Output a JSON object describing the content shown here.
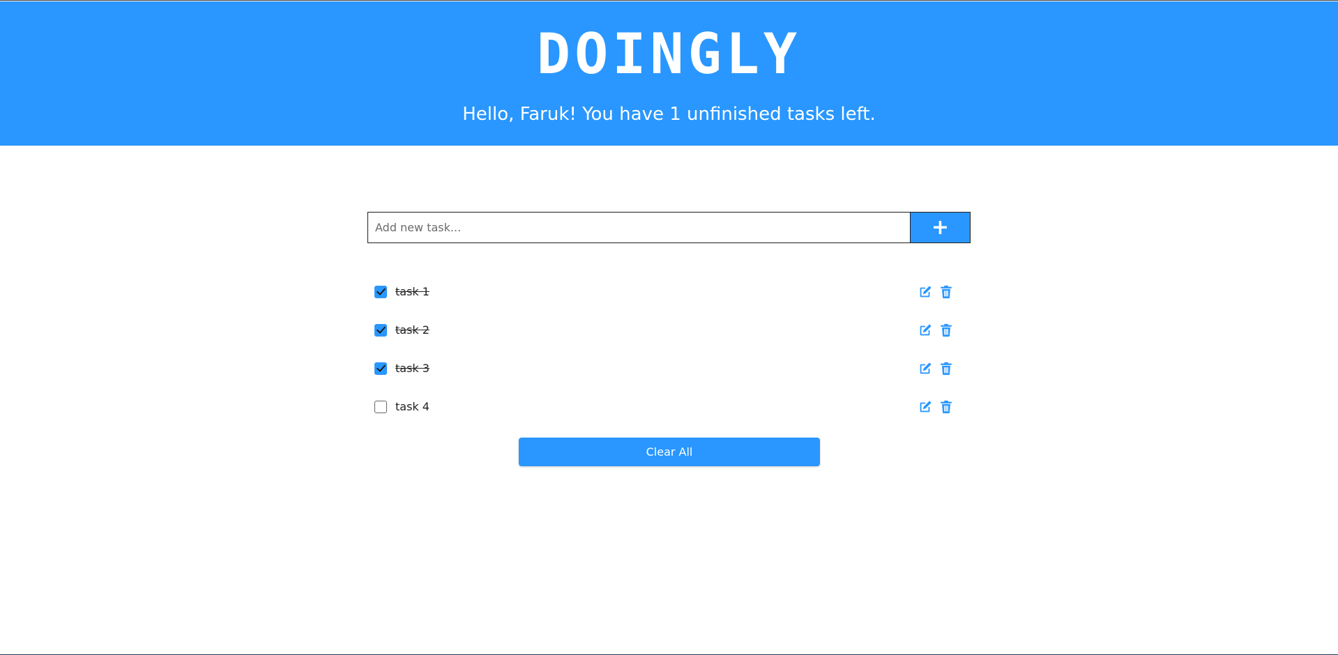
{
  "header": {
    "brand": "DOINGLY",
    "greeting": "Hello, Faruk! You have 1 unfinished tasks left."
  },
  "add_task": {
    "placeholder": "Add new task...",
    "button_label": "+"
  },
  "tasks": [
    {
      "label": "task 1",
      "checked": true
    },
    {
      "label": "task 2",
      "checked": true
    },
    {
      "label": "task 3",
      "checked": true
    },
    {
      "label": "task 4",
      "checked": false
    }
  ],
  "clear_all_label": "Clear All",
  "colors": {
    "accent": "#2997ff",
    "text": "#222222"
  },
  "icons": {
    "edit": "edit-icon",
    "delete": "trash-icon"
  }
}
